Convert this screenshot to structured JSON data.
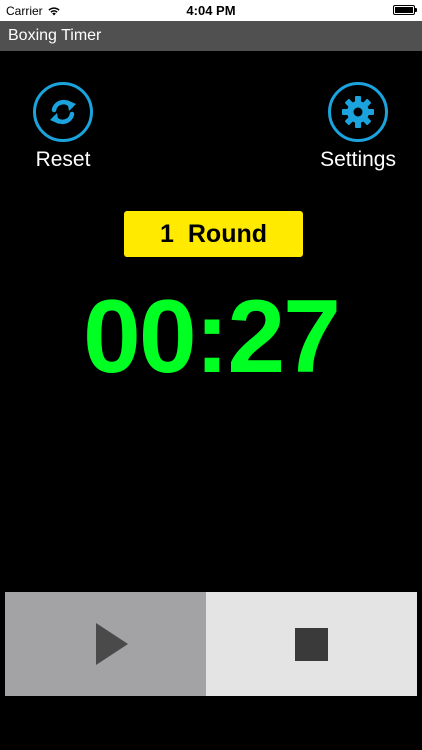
{
  "status_bar": {
    "carrier": "Carrier",
    "time": "4:04 PM",
    "battery_level": 1.0
  },
  "app": {
    "title": "Boxing Timer"
  },
  "controls": {
    "reset_label": "Reset",
    "reset_icon": "refresh-icon",
    "settings_label": "Settings",
    "settings_icon": "gear-icon",
    "accent_color": "#1aa3dc"
  },
  "round": {
    "number": "1",
    "label": "Round",
    "badge_color": "#ffea00"
  },
  "timer": {
    "display": "00:27",
    "color": "#00ff22"
  },
  "playback": {
    "play_icon": "play-icon",
    "stop_icon": "stop-icon"
  }
}
